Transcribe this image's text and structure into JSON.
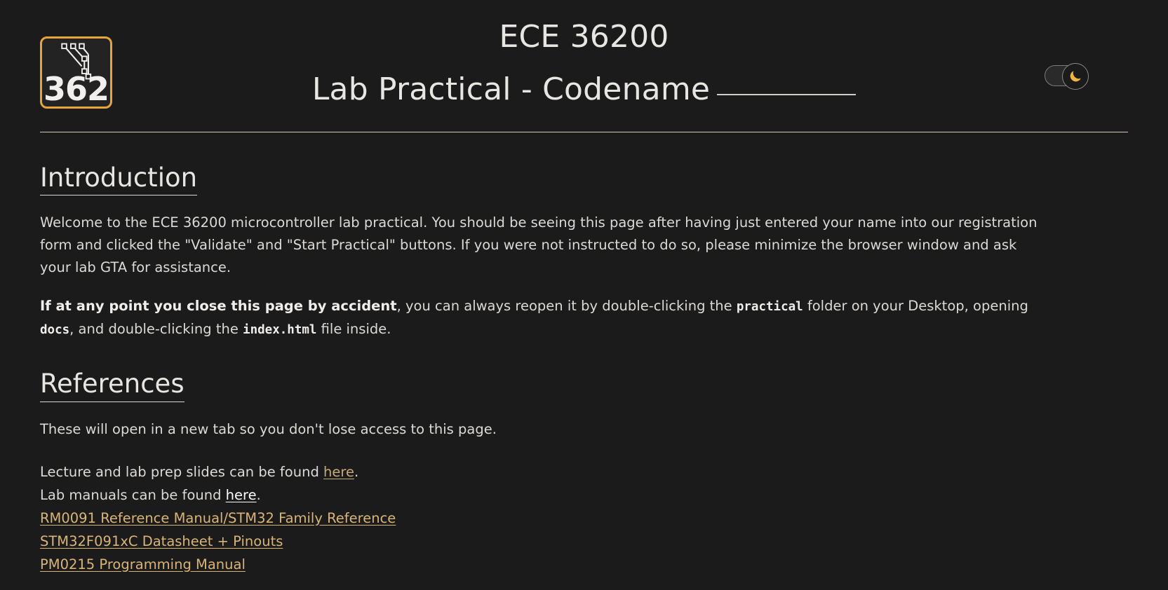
{
  "header": {
    "logo": {
      "number": "362",
      "icon": "circuit-trace-icon",
      "border_color": "#e8a33d"
    },
    "title_line1": "ECE 36200",
    "title_line2_prefix": "Lab Practical - Codename",
    "title_line2_blank": "__________",
    "theme_toggle": {
      "name": "dark-mode-toggle",
      "state": "on",
      "icon": "moon-icon",
      "icon_color": "#f0b440"
    }
  },
  "sections": {
    "introduction": {
      "heading": "Introduction",
      "paragraph1": "Welcome to the ECE 36200 microcontroller lab practical. You should be seeing this page after having just entered your name into our registration form and clicked the \"Validate\" and \"Start Practical\" buttons. If you were not instructed to do so, please minimize the browser window and ask your lab GTA for assistance.",
      "paragraph2": {
        "bold_lead": "If at any point you close this page by accident",
        "text_a": ", you can always reopen it by double-clicking the ",
        "code_a": "practical",
        "text_b": " folder on your Desktop, opening ",
        "code_b": "docs",
        "text_c": ", and double-clicking the ",
        "code_c": "index.html",
        "text_d": " file inside."
      }
    },
    "references": {
      "heading": "References",
      "intro": "These will open in a new tab so you don't lose access to this page.",
      "links": [
        {
          "prefix": "Lecture and lab prep slides can be found ",
          "link_text": "here",
          "suffix": ".",
          "style": "visited"
        },
        {
          "prefix": "Lab manuals can be found ",
          "link_text": "here",
          "suffix": ".",
          "style": "unvisited"
        },
        {
          "prefix": "",
          "link_text": "RM0091 Reference Manual/STM32 Family Reference",
          "suffix": "",
          "style": "gold"
        },
        {
          "prefix": "",
          "link_text": "STM32F091xC Datasheet + Pinouts",
          "suffix": "",
          "style": "gold"
        },
        {
          "prefix": "",
          "link_text": "PM0215 Programming Manual",
          "suffix": "",
          "style": "gold"
        }
      ]
    }
  },
  "colors": {
    "background": "#1b1b1b",
    "text": "#dcdad6",
    "accent": "#e8a33d",
    "link_gold": "#d9b478",
    "divider": "#d8c9a8"
  }
}
